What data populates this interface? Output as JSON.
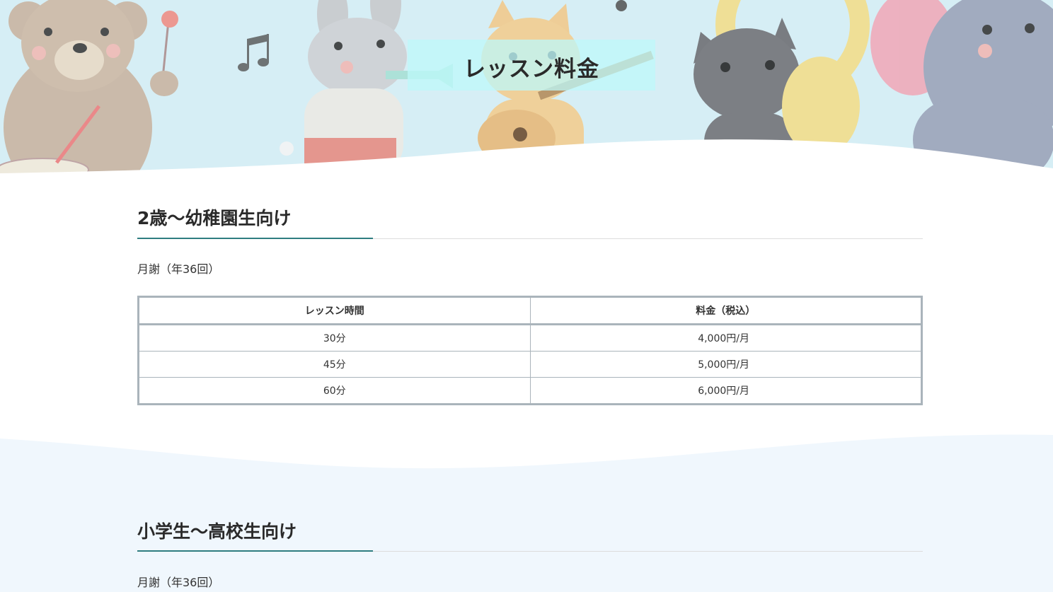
{
  "hero": {
    "title": "レッスン料金",
    "background_color": "#d6eef5",
    "title_box_color": "#bff7f9"
  },
  "sections": [
    {
      "heading": "2歳〜幼稚園生向け",
      "fee_note": "月謝（年36回）",
      "table": {
        "headers": [
          "レッスン時間",
          "料金（税込）"
        ],
        "rows": [
          [
            "30分",
            "4,000円/月"
          ],
          [
            "45分",
            "5,000円/月"
          ],
          [
            "60分",
            "6,000円/月"
          ]
        ]
      }
    },
    {
      "heading": "小学生〜高校生向け",
      "fee_note": "月謝（年36回）"
    }
  ],
  "colors": {
    "accent": "#2f7d80",
    "table_border": "#aab4bb",
    "lower_band": "#f0f7fd"
  },
  "decorations": [
    "bear-icon",
    "rabbit-icon",
    "cat-icon",
    "black-cat-icon",
    "elephant-icon",
    "music-note-icon"
  ]
}
